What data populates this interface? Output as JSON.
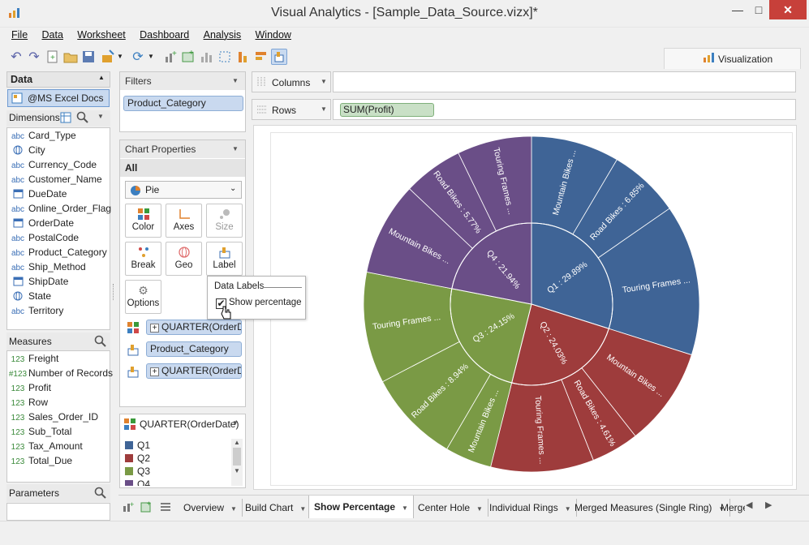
{
  "window": {
    "title": "Visual Analytics - [Sample_Data_Source.vizx]*"
  },
  "menu": [
    "File",
    "Data",
    "Worksheet",
    "Dashboard",
    "Analysis",
    "Window"
  ],
  "toolbar": {
    "visualization_tab": "Visualization"
  },
  "data_panel": {
    "title": "Data",
    "source": "@MS Excel Docs ...",
    "dimensions_title": "Dimensions",
    "dimensions": [
      {
        "type": "abc",
        "name": "Card_Type"
      },
      {
        "type": "geo",
        "name": "City"
      },
      {
        "type": "abc",
        "name": "Currency_Code"
      },
      {
        "type": "abc",
        "name": "Customer_Name"
      },
      {
        "type": "date",
        "name": "DueDate"
      },
      {
        "type": "abc",
        "name": "Online_Order_Flag"
      },
      {
        "type": "date",
        "name": "OrderDate"
      },
      {
        "type": "abc",
        "name": "PostalCode"
      },
      {
        "type": "abc",
        "name": "Product_Category"
      },
      {
        "type": "abc",
        "name": "Ship_Method"
      },
      {
        "type": "date",
        "name": "ShipDate"
      },
      {
        "type": "geo",
        "name": "State"
      },
      {
        "type": "abc",
        "name": "Territory"
      }
    ],
    "measures_title": "Measures",
    "measures": [
      {
        "type": "123",
        "name": "Freight"
      },
      {
        "type": "#123",
        "name": "Number of Records"
      },
      {
        "type": "123",
        "name": "Profit"
      },
      {
        "type": "123",
        "name": "Row"
      },
      {
        "type": "123",
        "name": "Sales_Order_ID"
      },
      {
        "type": "123",
        "name": "Sub_Total"
      },
      {
        "type": "123",
        "name": "Tax_Amount"
      },
      {
        "type": "123",
        "name": "Total_Due"
      }
    ],
    "parameters_title": "Parameters"
  },
  "filters": {
    "title": "Filters",
    "items": [
      "Product_Category"
    ]
  },
  "chart_properties": {
    "title": "Chart Properties",
    "scope": "All",
    "chart_type": "Pie",
    "buttons": [
      "Color",
      "Axes",
      "Size",
      "Break",
      "Geo",
      "Label",
      "Options"
    ],
    "marks": [
      "QUARTER(OrderD...",
      "Product_Category",
      "QUARTER(OrderD..."
    ]
  },
  "popup": {
    "title": "Data Labels",
    "checkbox_label": "Show percentage",
    "checked": true
  },
  "legend": {
    "title": "QUARTER(OrderDate)",
    "items": [
      {
        "label": "Q1",
        "color": "#3f6496"
      },
      {
        "label": "Q2",
        "color": "#9e3c3c"
      },
      {
        "label": "Q3",
        "color": "#7a9a45"
      },
      {
        "label": "Q4",
        "color": "#6a4e87"
      }
    ]
  },
  "shelves": {
    "columns_label": "Columns",
    "rows_label": "Rows",
    "rows_pill": "SUM(Profit)"
  },
  "axis_label_fragment": "SU",
  "chart_data": {
    "type": "pie",
    "subtype": "sunburst",
    "inner_ring": [
      {
        "label": "Q1 : 29.89%",
        "value": 29.89,
        "color": "#3f6496"
      },
      {
        "label": "Q2 : 24.03%",
        "value": 24.03,
        "color": "#9e3c3c"
      },
      {
        "label": "Q3 : 24.15%",
        "value": 24.15,
        "color": "#7a9a45"
      },
      {
        "label": "Q4 : 21.94%",
        "value": 21.94,
        "color": "#6a4e87"
      }
    ],
    "outer_ring": [
      {
        "parent": "Q1",
        "label": "Mountain Bikes ...",
        "value": 8.5
      },
      {
        "parent": "Q1",
        "label": "Road Bikes : 6.85%",
        "value": 6.85
      },
      {
        "parent": "Q1",
        "label": "Touring Frames ...",
        "value": 14.54
      },
      {
        "parent": "Q2",
        "label": "Mountain Bikes ...",
        "value": 9.5
      },
      {
        "parent": "Q2",
        "label": "Road Bikes : 4.61%",
        "value": 4.61
      },
      {
        "parent": "Q2",
        "label": "Touring Frames ...",
        "value": 9.92
      },
      {
        "parent": "Q3",
        "label": "Mountain Bikes ...",
        "value": 4.5
      },
      {
        "parent": "Q3",
        "label": "Road Bikes : 8.94%",
        "value": 8.94
      },
      {
        "parent": "Q3",
        "label": "Touring Frames ...",
        "value": 10.71
      },
      {
        "parent": "Q4",
        "label": "Mountain Bikes ...",
        "value": 9.0
      },
      {
        "parent": "Q4",
        "label": "Road Bikes : 5.77%",
        "value": 5.77
      },
      {
        "parent": "Q4",
        "label": "Touring Frames ...",
        "value": 7.17
      }
    ]
  },
  "sheet_tabs": [
    {
      "label": "Overview",
      "active": false
    },
    {
      "label": "Build Chart",
      "active": false
    },
    {
      "label": "Show Percentage",
      "active": true
    },
    {
      "label": "Center Hole",
      "active": false
    },
    {
      "label": "Individual Rings",
      "active": false
    },
    {
      "label": "Merged Measures (Single Ring)",
      "active": false
    },
    {
      "label": "Merge",
      "active": false
    }
  ]
}
